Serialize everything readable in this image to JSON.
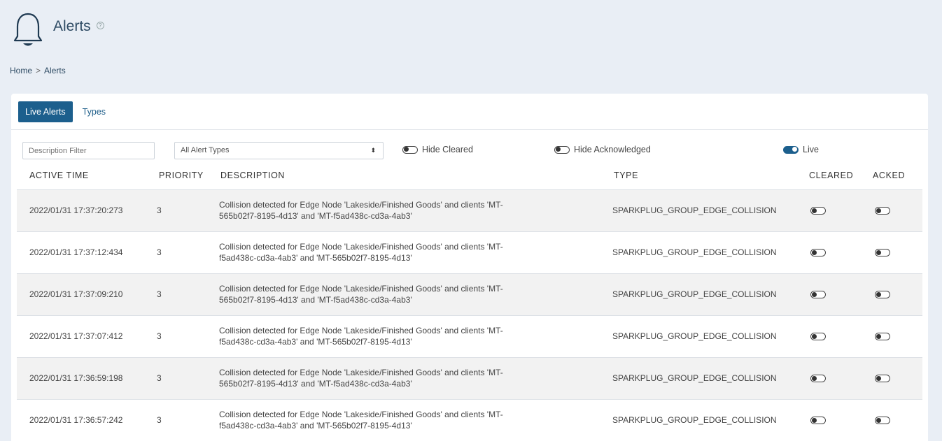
{
  "page": {
    "title": "Alerts",
    "help_glyph": "?",
    "breadcrumb": {
      "home": "Home",
      "separator": ">",
      "current": "Alerts"
    }
  },
  "tabs": [
    {
      "label": "Live Alerts",
      "active": true
    },
    {
      "label": "Types",
      "active": false
    }
  ],
  "filters": {
    "description_placeholder": "Description Filter",
    "alert_type_selected": "All Alert Types",
    "select_caret": "⬍",
    "hide_cleared_label": "Hide Cleared",
    "hide_cleared_on": false,
    "hide_acknowledged_label": "Hide Acknowledged",
    "hide_acknowledged_on": false,
    "live_label": "Live",
    "live_on": true
  },
  "table": {
    "headers": {
      "active_time": "ACTIVE TIME",
      "priority": "PRIORITY",
      "description": "DESCRIPTION",
      "type": "TYPE",
      "cleared": "CLEARED",
      "acked": "ACKED"
    },
    "rows": [
      {
        "time": "2022/01/31 17:37:20:273",
        "priority": "3",
        "desc1": "Collision detected for Edge Node 'Lakeside/Finished Goods' and clients 'MT-",
        "desc2": "565b02f7-8195-4d13' and 'MT-f5ad438c-cd3a-4ab3'",
        "type": "SPARKPLUG_GROUP_EDGE_COLLISION",
        "cleared": false,
        "acked": false
      },
      {
        "time": "2022/01/31 17:37:12:434",
        "priority": "3",
        "desc1": "Collision detected for Edge Node 'Lakeside/Finished Goods' and clients 'MT-",
        "desc2": "f5ad438c-cd3a-4ab3' and 'MT-565b02f7-8195-4d13'",
        "type": "SPARKPLUG_GROUP_EDGE_COLLISION",
        "cleared": false,
        "acked": false
      },
      {
        "time": "2022/01/31 17:37:09:210",
        "priority": "3",
        "desc1": "Collision detected for Edge Node 'Lakeside/Finished Goods' and clients 'MT-",
        "desc2": "565b02f7-8195-4d13' and 'MT-f5ad438c-cd3a-4ab3'",
        "type": "SPARKPLUG_GROUP_EDGE_COLLISION",
        "cleared": false,
        "acked": false
      },
      {
        "time": "2022/01/31 17:37:07:412",
        "priority": "3",
        "desc1": "Collision detected for Edge Node 'Lakeside/Finished Goods' and clients 'MT-",
        "desc2": "f5ad438c-cd3a-4ab3' and 'MT-565b02f7-8195-4d13'",
        "type": "SPARKPLUG_GROUP_EDGE_COLLISION",
        "cleared": false,
        "acked": false
      },
      {
        "time": "2022/01/31 17:36:59:198",
        "priority": "3",
        "desc1": "Collision detected for Edge Node 'Lakeside/Finished Goods' and clients 'MT-",
        "desc2": "565b02f7-8195-4d13' and 'MT-f5ad438c-cd3a-4ab3'",
        "type": "SPARKPLUG_GROUP_EDGE_COLLISION",
        "cleared": false,
        "acked": false
      },
      {
        "time": "2022/01/31 17:36:57:242",
        "priority": "3",
        "desc1": "Collision detected for Edge Node 'Lakeside/Finished Goods' and clients 'MT-",
        "desc2": "f5ad438c-cd3a-4ab3' and 'MT-565b02f7-8195-4d13'",
        "type": "SPARKPLUG_GROUP_EDGE_COLLISION",
        "cleared": false,
        "acked": false
      }
    ]
  },
  "icons": {
    "page_icon": "bell-icon",
    "help": "help-icon"
  },
  "colors": {
    "accent": "#1c5f8d",
    "title": "#2d4a63",
    "background": "#e9eef5",
    "row_stripe": "#f2f2f2"
  }
}
